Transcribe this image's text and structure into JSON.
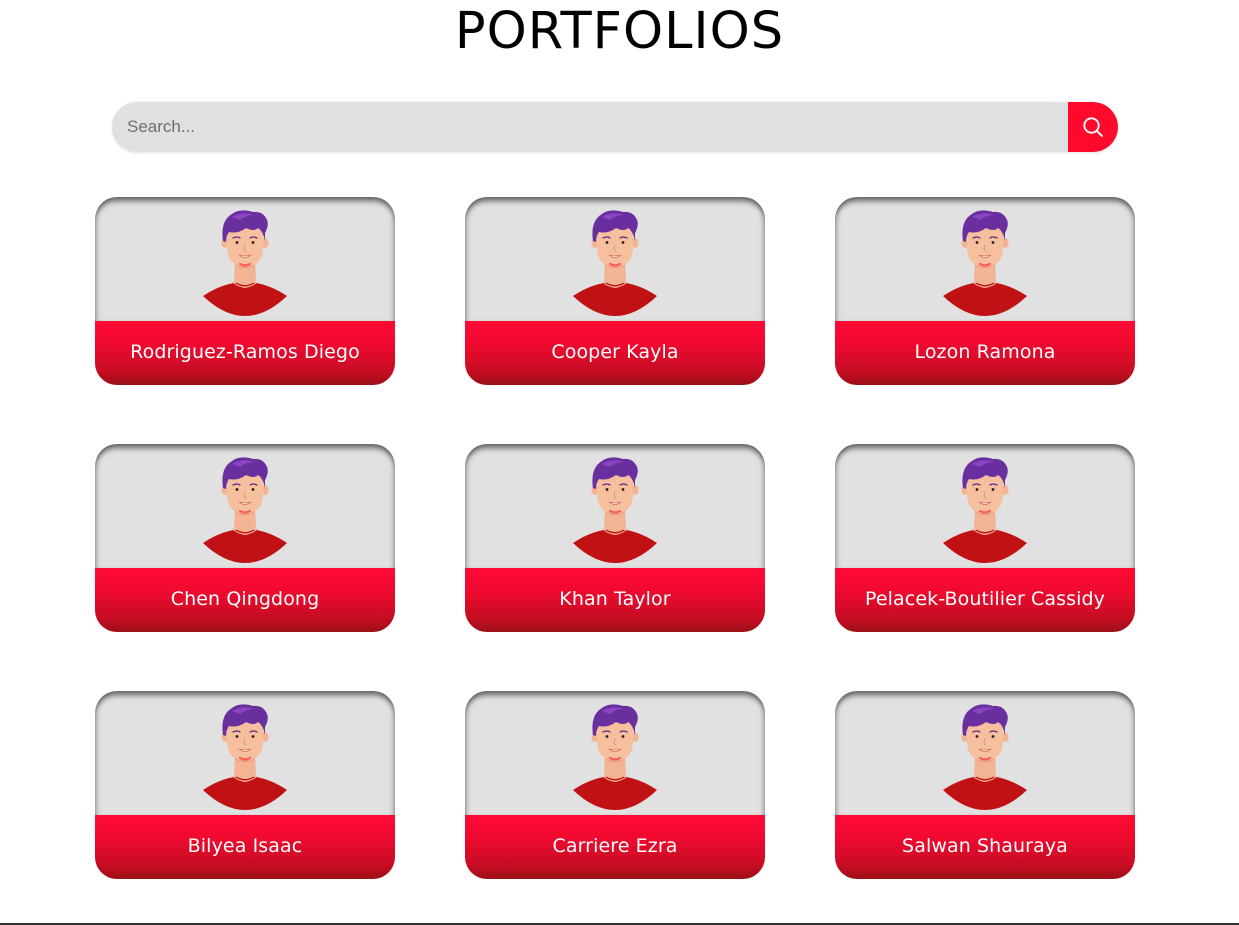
{
  "page_title": "PORTFOLIOS",
  "search": {
    "placeholder": "Search...",
    "value": "",
    "button_icon": "search-icon"
  },
  "colors": {
    "accent": "#ff0a2c",
    "card_background": "#e1e1e1",
    "search_background": "#e0e0e0"
  },
  "cards": [
    {
      "name": "Rodriguez-Ramos Diego",
      "avatar_icon": "person-avatar-icon"
    },
    {
      "name": "Cooper Kayla",
      "avatar_icon": "person-avatar-icon"
    },
    {
      "name": "Lozon Ramona",
      "avatar_icon": "person-avatar-icon"
    },
    {
      "name": "Chen Qingdong",
      "avatar_icon": "person-avatar-icon"
    },
    {
      "name": "Khan Taylor",
      "avatar_icon": "person-avatar-icon"
    },
    {
      "name": "Pelacek-Boutilier Cassidy",
      "avatar_icon": "person-avatar-icon"
    },
    {
      "name": "Bilyea Isaac",
      "avatar_icon": "person-avatar-icon"
    },
    {
      "name": "Carriere Ezra",
      "avatar_icon": "person-avatar-icon"
    },
    {
      "name": "Salwan Shauraya",
      "avatar_icon": "person-avatar-icon"
    }
  ]
}
